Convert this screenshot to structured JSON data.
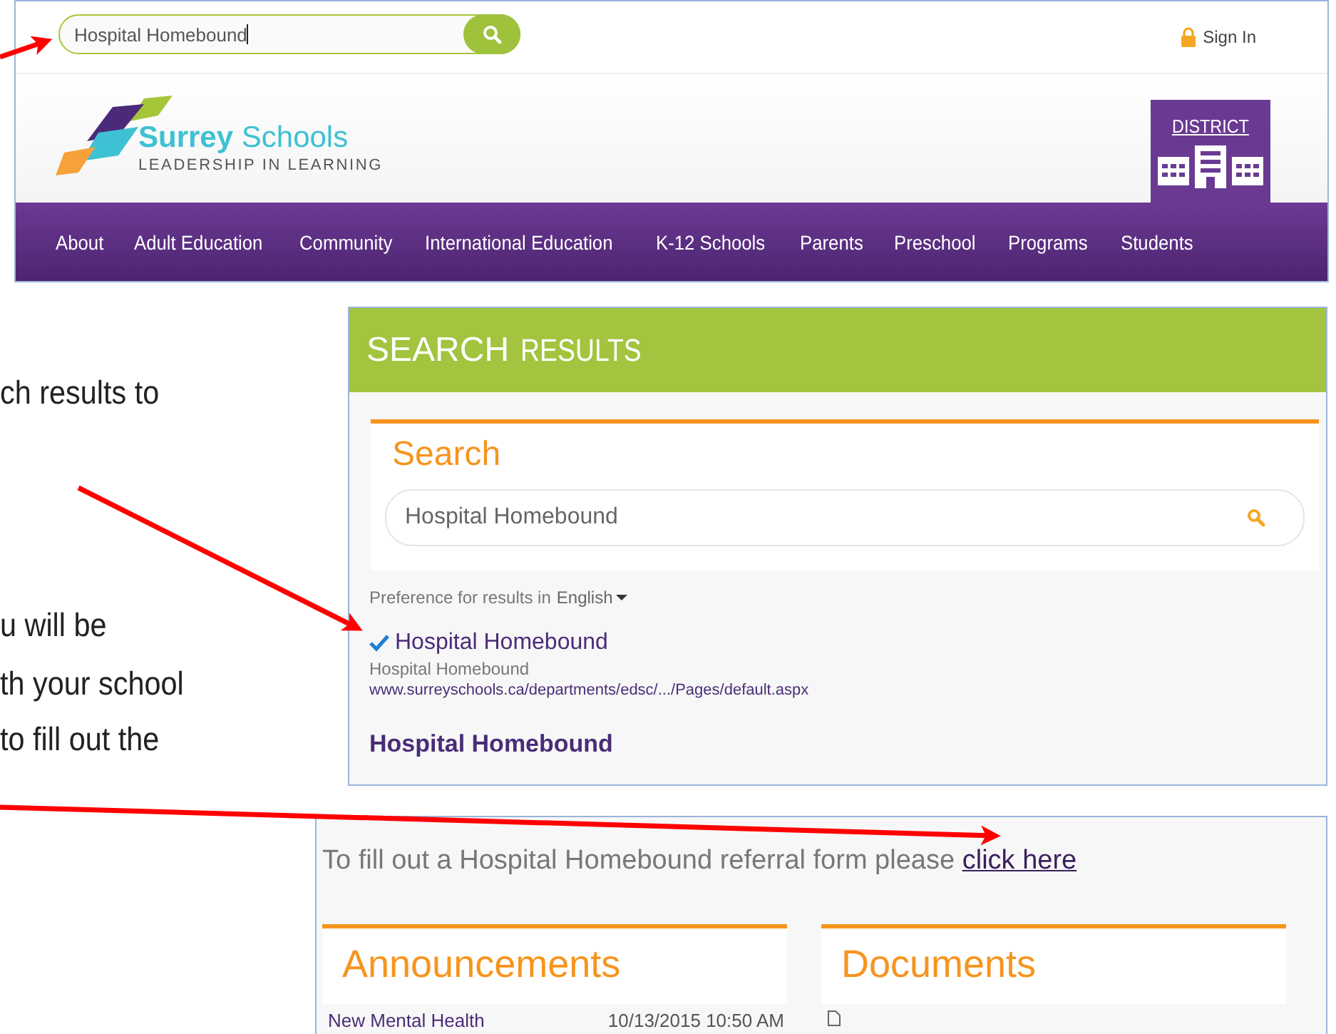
{
  "notes": [
    "ch results to",
    "u will be",
    "th your school",
    "to fill out the"
  ],
  "site_header": {
    "search": {
      "value": "Hospital Homebound"
    },
    "sign_in": "Sign In",
    "logo": {
      "name": "**Surrey** Schools",
      "tagline": "LEADERSHIP IN LEARNING"
    },
    "district": "DISTRICT",
    "nav": [
      "About",
      "Adult Education",
      "Community",
      "International Education",
      "K-12 Schools",
      "Parents",
      "Preschool",
      "Programs",
      "Students"
    ]
  },
  "results_page": {
    "banner": [
      "SEARCH",
      "RESULTS"
    ],
    "search_title": "Search",
    "search": {
      "value": "Hospital Homebound"
    },
    "preference": {
      "label": "Preference for results in",
      "language": "English"
    },
    "results": [
      {
        "title": "Hospital Homebound",
        "summary": "Hospital Homebound",
        "url": "www.surreyschools.ca/departments/edsc/.../Pages/default.aspx",
        "checked": true
      },
      {
        "title": "Hospital Homebound",
        "checked": false
      }
    ]
  },
  "program_page": {
    "intro": "To fill out a Hospital Homebound referral form please",
    "link": "click here",
    "announcements": {
      "title": "Announcements",
      "items": [
        {
          "title": "New Mental Health",
          "date": "10/13/2015 10:50 AM"
        }
      ]
    },
    "documents": {
      "title": "Documents"
    }
  }
}
